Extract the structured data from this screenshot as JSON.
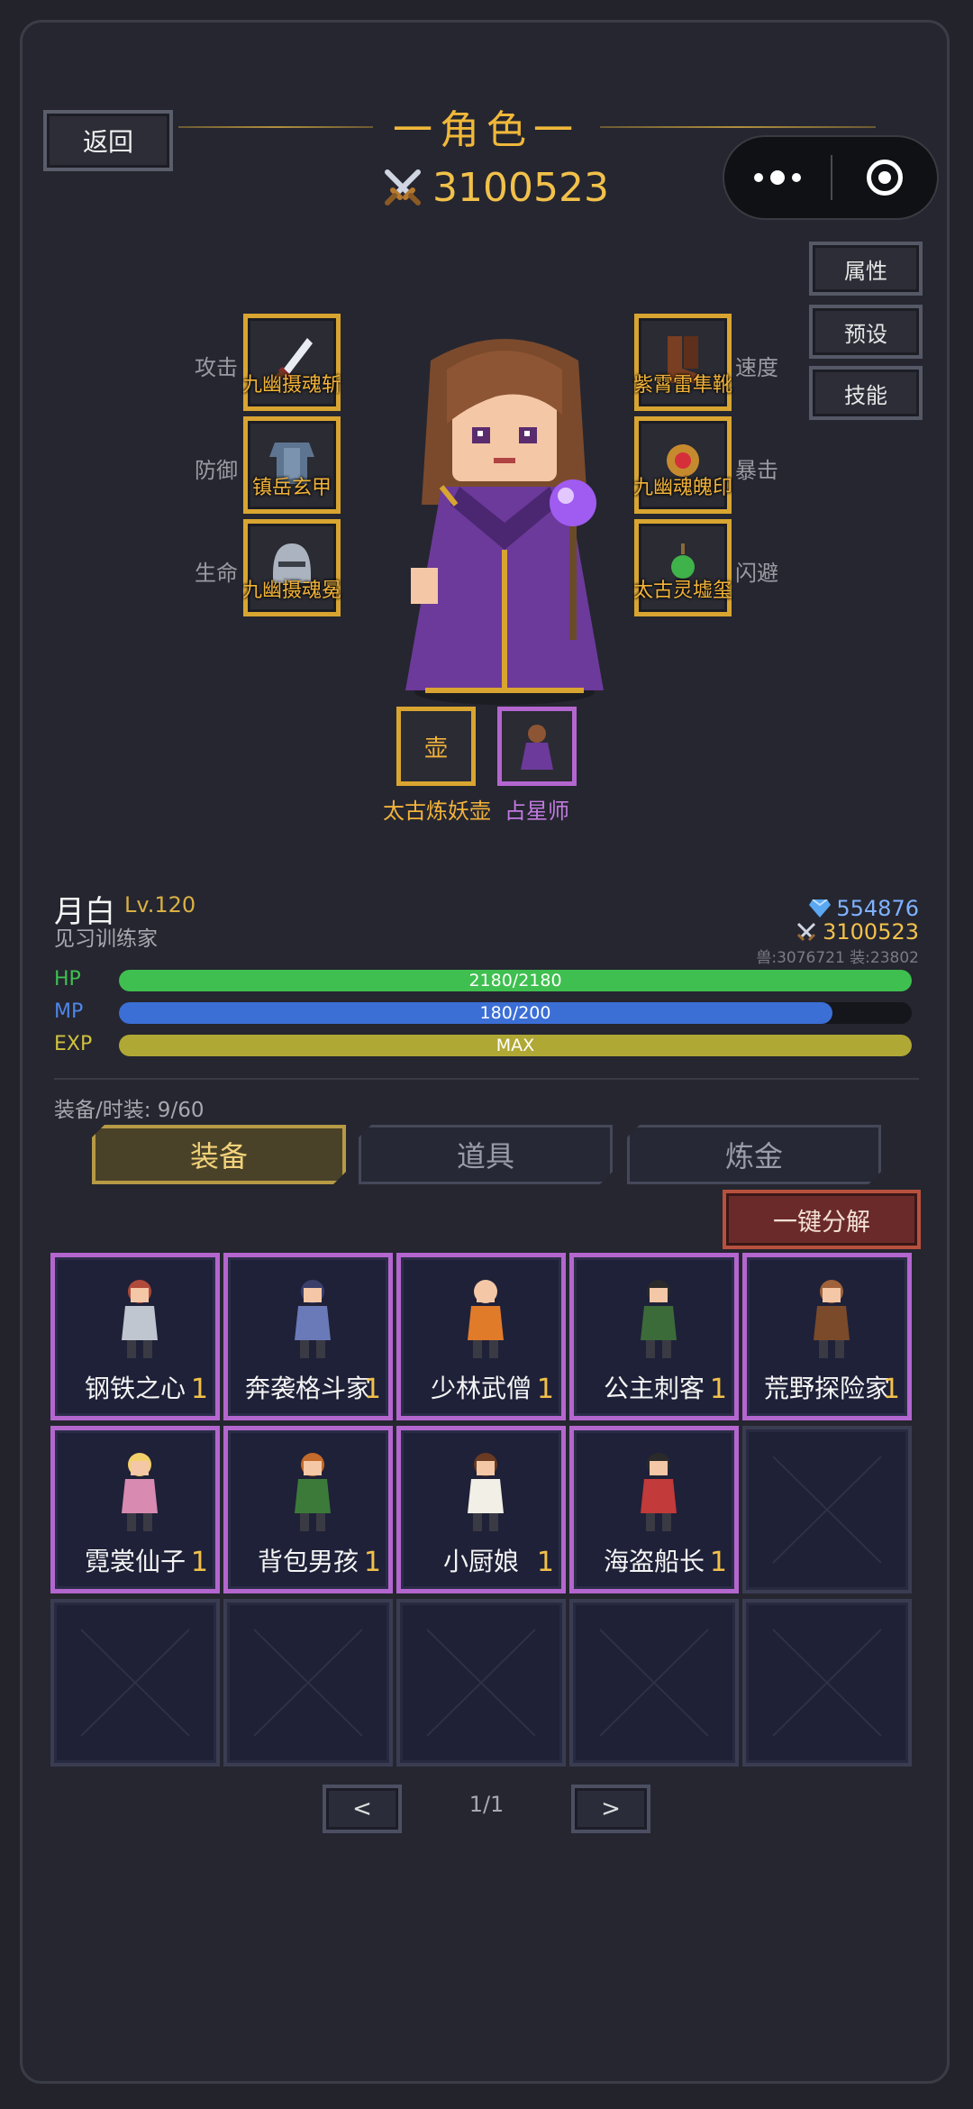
{
  "header": {
    "back_label": "返回",
    "title": "一角色一",
    "combat_power": "3100523"
  },
  "side_menu": {
    "attributes": "属性",
    "preset": "预设",
    "skills": "技能"
  },
  "equipment_slots": {
    "left": [
      {
        "stat": "攻击",
        "name": "九幽摄魂斩",
        "icon": "sword-icon"
      },
      {
        "stat": "防御",
        "name": "镇岳玄甲",
        "icon": "armor-icon"
      },
      {
        "stat": "生命",
        "name": "九幽摄魂冕",
        "icon": "helmet-icon"
      }
    ],
    "right": [
      {
        "stat": "速度",
        "name": "紫霄雷隼靴",
        "icon": "boots-icon"
      },
      {
        "stat": "暴击",
        "name": "九幽魂魄印",
        "icon": "seal-icon"
      },
      {
        "stat": "闪避",
        "name": "太古灵墟玺",
        "icon": "jade-icon"
      }
    ],
    "extra": [
      {
        "name": "太古炼妖壶",
        "glyph": "壶",
        "color": "#d9a531"
      },
      {
        "name": "占星师",
        "color": "#b466cf"
      }
    ]
  },
  "character": {
    "name": "月白",
    "level": "Lv.120",
    "rank": "见习训练家",
    "gems": "554876",
    "power": "3100523",
    "sub_stats": "兽:3076721 装:23802"
  },
  "bars": [
    {
      "label": "HP",
      "text": "2180/2180",
      "fill": 1.0,
      "color": "#3fbf4f",
      "label_color": "#3fbf4f"
    },
    {
      "label": "MP",
      "text": "180/200",
      "fill": 0.9,
      "color": "#3b6fd6",
      "label_color": "#4f86e8"
    },
    {
      "label": "EXP",
      "text": "MAX",
      "fill": 1.0,
      "color": "#b0a835",
      "label_color": "#cfc23e"
    }
  ],
  "inventory": {
    "count_label": "装备/时装: 9/60",
    "tabs": [
      "装备",
      "道具",
      "炼金"
    ],
    "decompose_label": "一键分解",
    "items": [
      {
        "name": "钢铁之心",
        "count": "1"
      },
      {
        "name": "奔袭格斗家",
        "count": "1"
      },
      {
        "name": "少林武僧",
        "count": "1"
      },
      {
        "name": "公主刺客",
        "count": "1"
      },
      {
        "name": "荒野探险家",
        "count": "1"
      },
      {
        "name": "霓裳仙子",
        "count": "1"
      },
      {
        "name": "背包男孩",
        "count": "1"
      },
      {
        "name": "小厨娘",
        "count": "1"
      },
      {
        "name": "海盗船长",
        "count": "1"
      }
    ],
    "total_cells": 15
  },
  "pager": {
    "prev": "<",
    "next": ">",
    "page": "1/1"
  }
}
